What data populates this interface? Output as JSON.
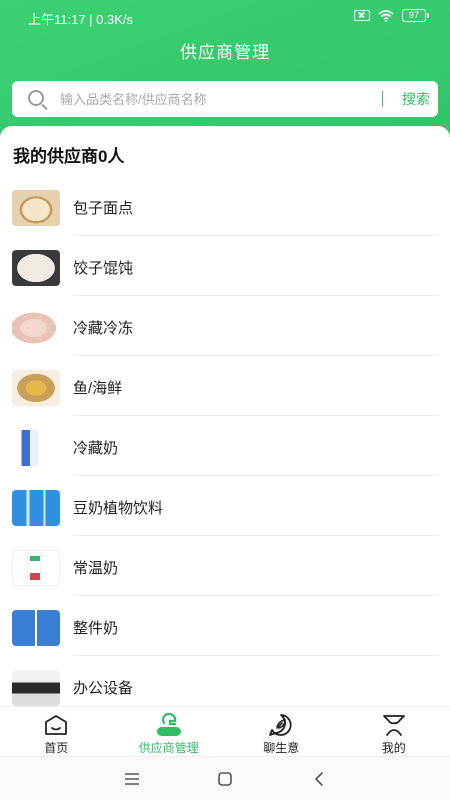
{
  "status_bar": {
    "time_speed": "上午11:17 | 0.3K/s",
    "battery": "97"
  },
  "header": {
    "title": "供应商管理"
  },
  "search": {
    "placeholder": "输入品类名称/供应商名称",
    "button_label": "搜索"
  },
  "section": {
    "title": "我的供应商0人"
  },
  "categories": [
    {
      "label": "包子面点",
      "icon": "buns-thumbnail"
    },
    {
      "label": "饺子馄饨",
      "icon": "dumplings-thumbnail"
    },
    {
      "label": "冷藏冷冻",
      "icon": "frozen-chicken-thumbnail"
    },
    {
      "label": "鱼/海鲜",
      "icon": "fish-thumbnail"
    },
    {
      "label": "冷藏奶",
      "icon": "chilled-milk-thumbnail"
    },
    {
      "label": "豆奶植物饮料",
      "icon": "soy-milk-thumbnail"
    },
    {
      "label": "常温奶",
      "icon": "ambient-milk-thumbnail"
    },
    {
      "label": "整件奶",
      "icon": "milk-case-thumbnail"
    },
    {
      "label": "办公设备",
      "icon": "printer-thumbnail"
    }
  ],
  "tabs": [
    {
      "label": "首页",
      "icon": "home-icon"
    },
    {
      "label": "供应商管理",
      "icon": "supplier-icon",
      "active": true
    },
    {
      "label": "聊生意",
      "icon": "chat-leaf-icon"
    },
    {
      "label": "我的",
      "icon": "profile-icon"
    }
  ],
  "colors": {
    "brand_green": "#35c96c",
    "accent_text_green": "#2fbf62"
  }
}
